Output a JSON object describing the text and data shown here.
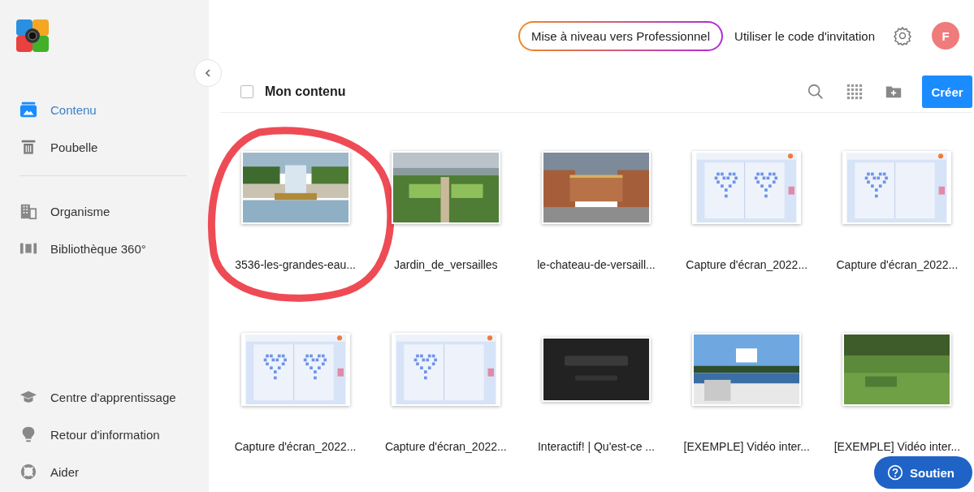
{
  "sidebar": {
    "items": [
      {
        "label": "Contenu",
        "selected": true
      },
      {
        "label": "Poubelle",
        "selected": false
      }
    ],
    "org_items": [
      {
        "label": "Organisme",
        "selected": false
      },
      {
        "label": "Bibliothèque 360°",
        "selected": false
      }
    ],
    "bottom_items": [
      {
        "label": "Centre d'apprentissage"
      },
      {
        "label": "Retour d'information"
      },
      {
        "label": "Aider"
      }
    ]
  },
  "header": {
    "upgrade": "Mise à niveau vers Professionnel",
    "invite": "Utiliser le code d'invitation",
    "avatar": "F"
  },
  "toolbar": {
    "title": "Mon contenu",
    "checked": false,
    "create": "Créer"
  },
  "items": [
    {
      "name": "3536-les-grandes-eau...",
      "circled": true
    },
    {
      "name": "Jardin_de_versailles",
      "circled": false
    },
    {
      "name": "le-chateau-de-versaill...",
      "circled": false
    },
    {
      "name": "Capture d'écran_2022...",
      "kind": "screenshot",
      "circled": false
    },
    {
      "name": "Capture d'écran_2022...",
      "kind": "screenshot",
      "circled": false
    },
    {
      "name": "Capture d'écran_2022...",
      "kind": "screenshot",
      "circled": false
    },
    {
      "name": "Capture d'écran_2022...",
      "kind": "screenshot",
      "circled": false
    },
    {
      "name": "Interactif! | Qu'est-ce ...",
      "kind": "video",
      "circled": false
    },
    {
      "name": "[EXEMPLE] Vidéo inter...",
      "circled": false
    },
    {
      "name": "[EXEMPLE] Vidéo inter...",
      "circled": false
    }
  ],
  "support": "Soutien"
}
